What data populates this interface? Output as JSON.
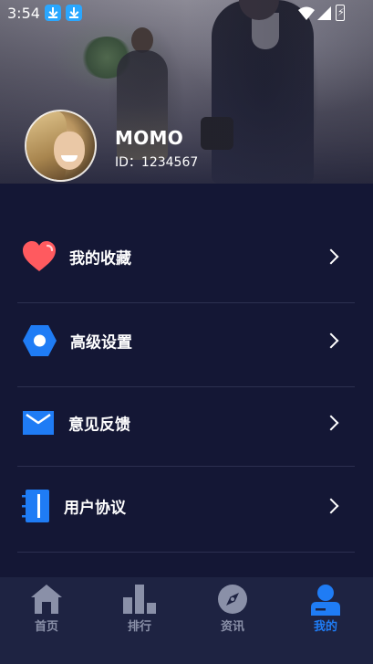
{
  "status_bar": {
    "time": "3:54",
    "icons": [
      "download-icon",
      "download-icon",
      "wifi-icon",
      "signal-icon",
      "battery-charging-icon"
    ]
  },
  "profile": {
    "username": "MOMO",
    "id_text": "ID：1234567"
  },
  "menu": {
    "items": [
      {
        "label": "我的收藏",
        "icon": "heart-icon"
      },
      {
        "label": "高级设置",
        "icon": "settings-hexagon-icon"
      },
      {
        "label": "意见反馈",
        "icon": "envelope-icon"
      },
      {
        "label": "用户协议",
        "icon": "notebook-icon"
      }
    ]
  },
  "bottom_nav": {
    "items": [
      {
        "label": "首页",
        "icon": "home-icon"
      },
      {
        "label": "排行",
        "icon": "ranking-bars-icon"
      },
      {
        "label": "资讯",
        "icon": "compass-icon"
      },
      {
        "label": "我的",
        "icon": "user-icon",
        "active": true
      }
    ]
  },
  "colors": {
    "background": "#141735",
    "nav_background": "#1e2342",
    "accent": "#1f7cf5",
    "nav_inactive": "#8a90a8",
    "heart": "#ff5a5f",
    "divider": "#2c3050"
  }
}
